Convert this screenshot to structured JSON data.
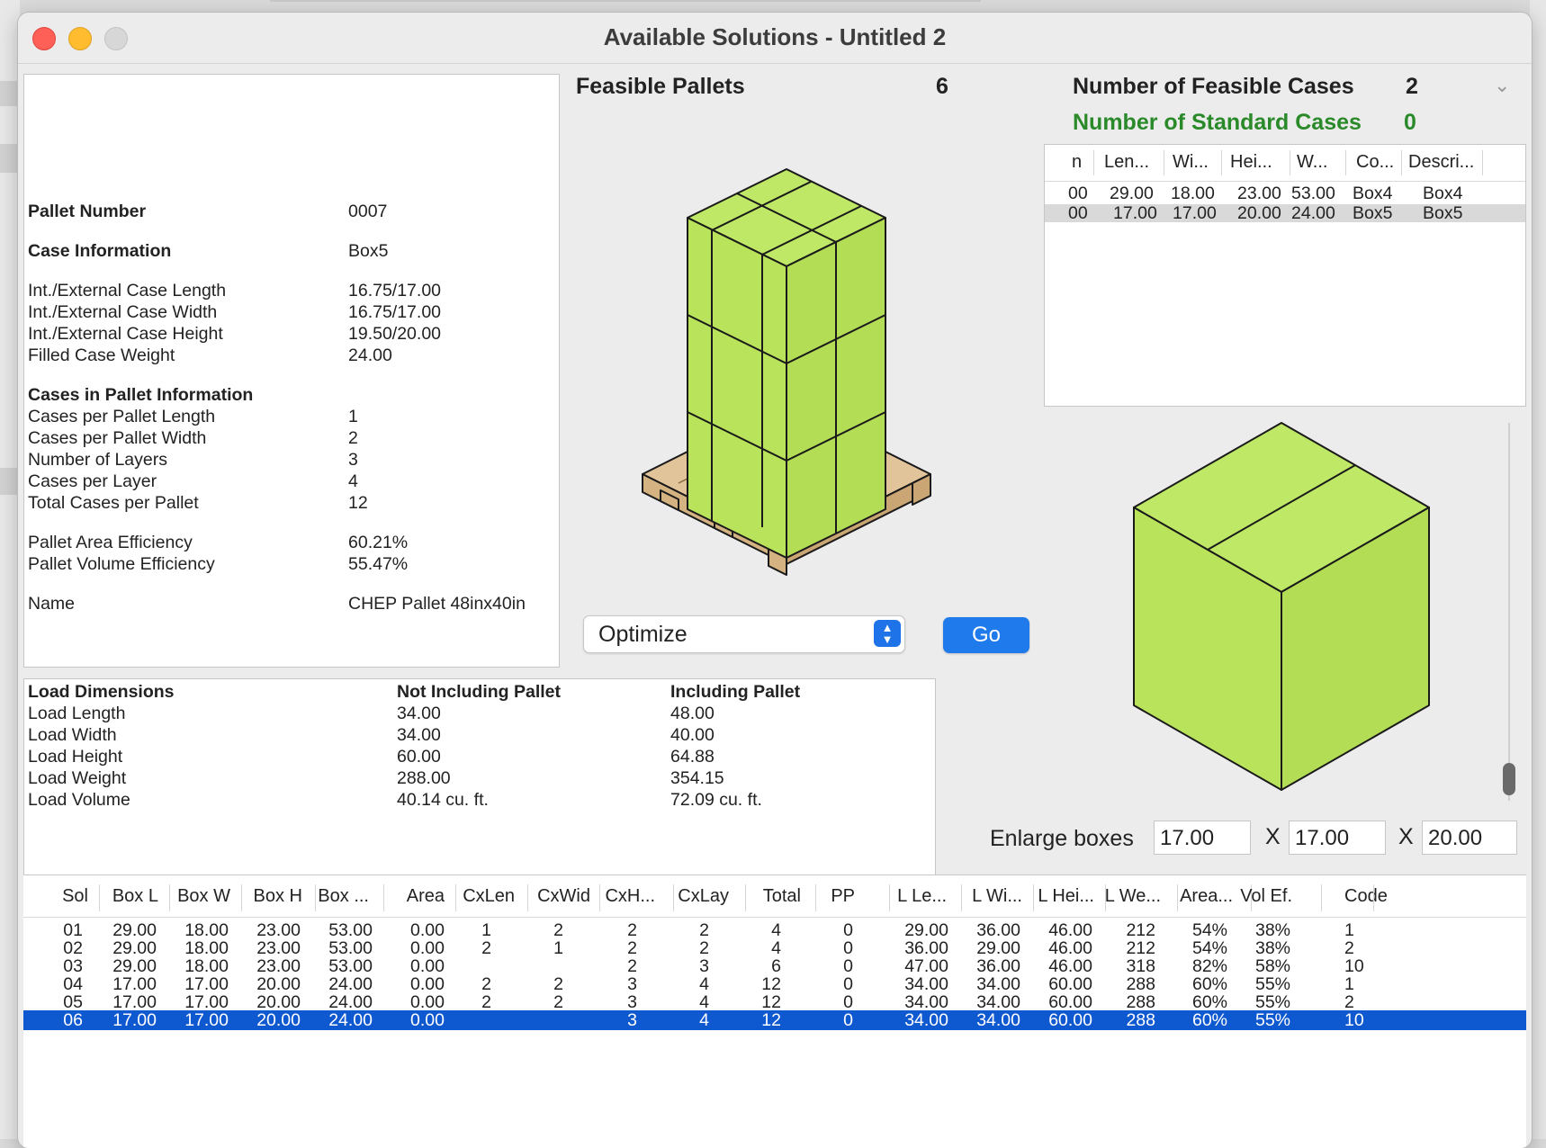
{
  "window": {
    "title": "Available Solutions - Untitled 2"
  },
  "info": {
    "pallet_number_label": "Pallet Number",
    "pallet_number": "0007",
    "case_info_label": "Case Information",
    "case_info": "Box5",
    "int_ext_length_label": "Int./External Case Length",
    "int_ext_length": "16.75/17.00",
    "int_ext_width_label": "Int./External Case Width",
    "int_ext_width": "16.75/17.00",
    "int_ext_height_label": "Int./External Case Height",
    "int_ext_height": "19.50/20.00",
    "filled_weight_label": "Filled Case Weight",
    "filled_weight": "24.00",
    "cases_in_pallet_label": "Cases in Pallet Information",
    "cases_per_length_label": "Cases per Pallet Length",
    "cases_per_length": "1",
    "cases_per_width_label": "Cases per Pallet Width",
    "cases_per_width": "2",
    "num_layers_label": "Number of Layers",
    "num_layers": "3",
    "cases_per_layer_label": "Cases per Layer",
    "cases_per_layer": "4",
    "total_cases_label": "Total Cases per Pallet",
    "total_cases": "12",
    "area_eff_label": "Pallet Area Efficiency",
    "area_eff": "60.21%",
    "volume_eff_label": "Pallet Volume Efficiency",
    "volume_eff": "55.47%",
    "name_label": "Name",
    "name": "CHEP Pallet 48inx40in"
  },
  "load": {
    "headers": [
      "Load Dimensions",
      "Not Including Pallet",
      "Including Pallet"
    ],
    "rows": [
      [
        "Load Length",
        "34.00",
        "48.00"
      ],
      [
        "Load Width",
        "34.00",
        "40.00"
      ],
      [
        "Load Height",
        "60.00",
        "64.88"
      ],
      [
        "Load Weight",
        "288.00",
        "354.15"
      ],
      [
        "Load Volume",
        "40.14 cu. ft.",
        "72.09 cu. ft."
      ]
    ]
  },
  "feasible": {
    "label": "Feasible Pallets",
    "count": "6"
  },
  "cases_summary": {
    "feasible_label": "Number of Feasible Cases",
    "feasible_count": "2",
    "standard_label": "Number of Standard Cases",
    "standard_count": "0"
  },
  "cases_table": {
    "headers": [
      "n",
      "Len...",
      "Wi...",
      "Hei...",
      "W...",
      "Co...",
      "Descri..."
    ],
    "rows": [
      [
        "00",
        "29.00",
        "18.00",
        "23.00",
        "53.00",
        "Box4",
        "Box4"
      ],
      [
        "00",
        "17.00",
        "17.00",
        "20.00",
        "24.00",
        "Box5",
        "Box5"
      ]
    ]
  },
  "controls": {
    "optimize_label": "Optimize",
    "go_label": "Go"
  },
  "enlarge": {
    "label": "Enlarge boxes",
    "x_label": "X",
    "l": "17.00",
    "w": "17.00",
    "h": "20.00"
  },
  "solutions": {
    "headers": [
      "Sol",
      "Box L",
      "Box W",
      "Box H",
      "Box ...",
      "Area",
      "CxLen",
      "CxWid",
      "CxH...",
      "CxLay",
      "Total",
      "PP",
      "L Le...",
      "L Wi...",
      "L Hei...",
      "L We...",
      "Area...",
      "Vol Ef.",
      "Code"
    ],
    "rows": [
      [
        "01",
        "29.00",
        "18.00",
        "23.00",
        "53.00",
        "0.00",
        "1",
        "2",
        "2",
        "2",
        "4",
        "0",
        "29.00",
        "36.00",
        "46.00",
        "212",
        "54%",
        "38%",
        "1"
      ],
      [
        "02",
        "29.00",
        "18.00",
        "23.00",
        "53.00",
        "0.00",
        "2",
        "1",
        "2",
        "2",
        "4",
        "0",
        "36.00",
        "29.00",
        "46.00",
        "212",
        "54%",
        "38%",
        "2"
      ],
      [
        "03",
        "29.00",
        "18.00",
        "23.00",
        "53.00",
        "0.00",
        "",
        "",
        "2",
        "3",
        "6",
        "0",
        "47.00",
        "36.00",
        "46.00",
        "318",
        "82%",
        "58%",
        "10"
      ],
      [
        "04",
        "17.00",
        "17.00",
        "20.00",
        "24.00",
        "0.00",
        "2",
        "2",
        "3",
        "4",
        "12",
        "0",
        "34.00",
        "34.00",
        "60.00",
        "288",
        "60%",
        "55%",
        "1"
      ],
      [
        "05",
        "17.00",
        "17.00",
        "20.00",
        "24.00",
        "0.00",
        "2",
        "2",
        "3",
        "4",
        "12",
        "0",
        "34.00",
        "34.00",
        "60.00",
        "288",
        "60%",
        "55%",
        "2"
      ],
      [
        "06",
        "17.00",
        "17.00",
        "20.00",
        "24.00",
        "0.00",
        "",
        "",
        "3",
        "4",
        "12",
        "0",
        "34.00",
        "34.00",
        "60.00",
        "288",
        "60%",
        "55%",
        "10"
      ]
    ],
    "selected_row": 5
  },
  "colors": {
    "box_green": "#b8e35a",
    "pallet_tan": "#e2c49a",
    "selection_blue": "#0e58d0",
    "accent_blue": "#1f7aeb",
    "standard_green": "#2a8a2a"
  },
  "icons": {
    "updown": "updown-chevron-icon",
    "collapse": "chevron-down-icon"
  }
}
